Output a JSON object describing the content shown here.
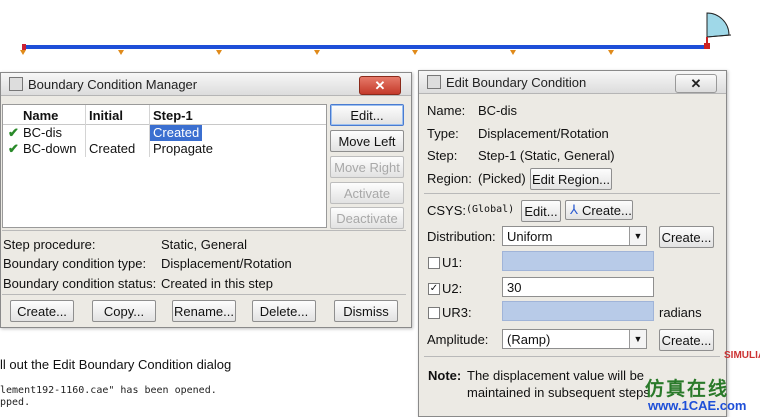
{
  "bcm": {
    "title": "Boundary Condition Manager",
    "columns": [
      "Name",
      "Initial",
      "Step-1"
    ],
    "rows": [
      {
        "check": "✔",
        "name": "BC-dis",
        "initial": "",
        "step1": "Created"
      },
      {
        "check": "✔",
        "name": "BC-down",
        "initial": "Created",
        "step1": "Propagate"
      }
    ],
    "side_buttons": [
      "Edit...",
      "Move Left",
      "Move Right",
      "Activate",
      "Deactivate"
    ],
    "info_labels": [
      "Step procedure:",
      "Boundary condition type:",
      "Boundary condition status:"
    ],
    "info_values": [
      "Static, General",
      "Displacement/Rotation",
      "Created in this step"
    ],
    "bottom_buttons": [
      "Create...",
      "Copy...",
      "Rename...",
      "Delete...",
      "Dismiss"
    ]
  },
  "ebc": {
    "title": "Edit Boundary Condition",
    "name_label": "Name:",
    "name_value": "BC-dis",
    "type_label": "Type:",
    "type_value": "Displacement/Rotation",
    "step_label": "Step:",
    "step_value": "Step-1 (Static, General)",
    "region_label": "Region:",
    "region_value": "(Picked)",
    "edit_region": "Edit Region...",
    "csys_label": "CSYS:",
    "csys_value": "(Global)",
    "csys_edit": "Edit...",
    "csys_create": "Create...",
    "dist_label": "Distribution:",
    "dist_value": "Uniform",
    "dist_create": "Create...",
    "u1_label": "U1:",
    "u2_label": "U2:",
    "u2_value": "30",
    "ur3_label": "UR3:",
    "ur3_unit": "radians",
    "amp_label": "Amplitude:",
    "amp_value": "(Ramp)",
    "amp_create": "Create...",
    "note_label": "Note:",
    "note_line1": "The displacement value will be",
    "note_line2": "maintained in subsequent steps"
  },
  "prompt": "ll out the Edit Boundary Condition dialog",
  "console": [
    "lement192-1160.cae\" has been opened.",
    "pped."
  ],
  "watermark": {
    "cn": "仿真在线",
    "url": "www.1CAE.com"
  },
  "simulia_text": "SIMULIA"
}
